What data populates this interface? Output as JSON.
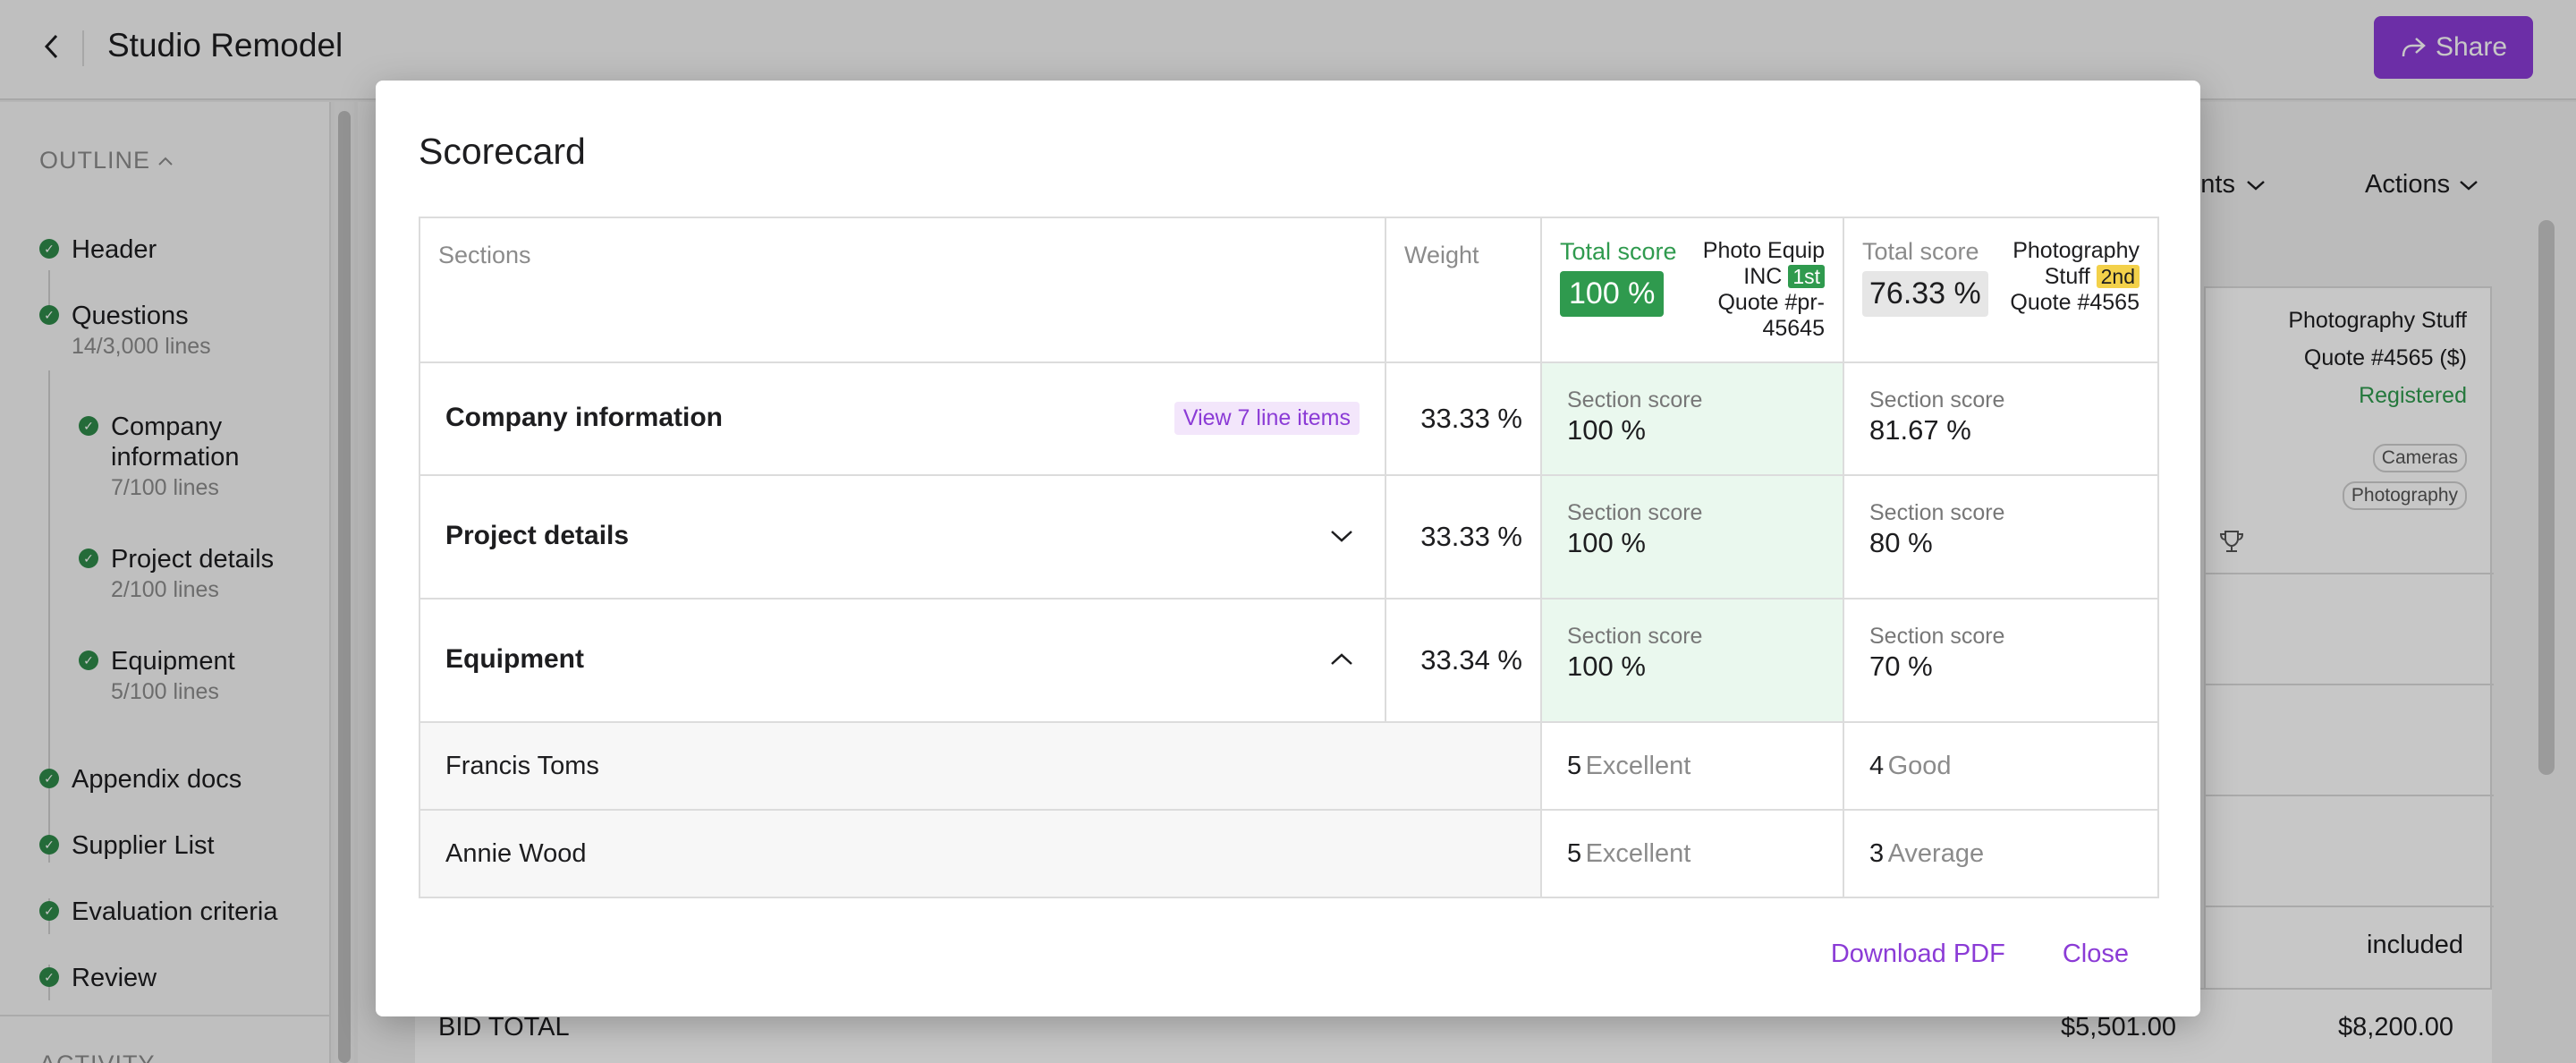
{
  "header": {
    "title": "Studio Remodel",
    "share_label": "Share"
  },
  "sidebar": {
    "outline_label": "OUTLINE",
    "items": [
      {
        "label": "Header",
        "sub": ""
      },
      {
        "label": "Questions",
        "sub": "14/3,000 lines"
      },
      {
        "label": "Company information",
        "sub": "7/100 lines"
      },
      {
        "label": "Project details",
        "sub": "2/100 lines"
      },
      {
        "label": "Equipment",
        "sub": "5/100 lines"
      },
      {
        "label": "Appendix docs",
        "sub": ""
      },
      {
        "label": "Supplier List",
        "sub": ""
      },
      {
        "label": "Evaluation criteria",
        "sub": ""
      },
      {
        "label": "Review",
        "sub": ""
      }
    ],
    "activity_label": "ACTIVITY"
  },
  "background": {
    "documents_label": "ments",
    "actions_label": "Actions",
    "vendor_name": "Photography Stuff",
    "vendor_quote": "Quote #4565 ($)",
    "vendor_status": "Registered",
    "chip_1": "Cameras",
    "chip_2": "Photography",
    "included": "included",
    "bid_total_label": "BID TOTAL",
    "bid_total_1": "$5,501.00",
    "bid_total_2": "$8,200.00"
  },
  "modal": {
    "title": "Scorecard",
    "columns": {
      "sections": "Sections",
      "weight": "Weight",
      "vendors": [
        {
          "total_label": "Total score",
          "total": "100 %",
          "name": "Photo Equip INC",
          "rank": "1st",
          "quote": "Quote #pr-45645"
        },
        {
          "total_label": "Total score",
          "total": "76.33 %",
          "name": "Photography Stuff",
          "rank": "2nd",
          "quote": "Quote #4565"
        }
      ]
    },
    "sections": [
      {
        "name": "Company information",
        "action": "View 7 line items",
        "weight": "33.33 %",
        "scores": [
          "100 %",
          "81.67 %"
        ]
      },
      {
        "name": "Project details",
        "weight": "33.33 %",
        "scores": [
          "100 %",
          "80 %"
        ]
      },
      {
        "name": "Equipment",
        "weight": "33.34 %",
        "scores": [
          "100 %",
          "70 %"
        ]
      }
    ],
    "section_score_label": "Section score",
    "evaluators": [
      {
        "name": "Francis Toms",
        "ratings": [
          {
            "num": "5",
            "word": "Excellent"
          },
          {
            "num": "4",
            "word": "Good"
          }
        ]
      },
      {
        "name": "Annie Wood",
        "ratings": [
          {
            "num": "5",
            "word": "Excellent"
          },
          {
            "num": "3",
            "word": "Average"
          }
        ]
      }
    ],
    "footer": {
      "download_label": "Download PDF",
      "close_label": "Close"
    }
  },
  "colors": {
    "accent": "#8b3bd6",
    "success": "#2f9a4e",
    "rank_second": "#f3d14a"
  }
}
